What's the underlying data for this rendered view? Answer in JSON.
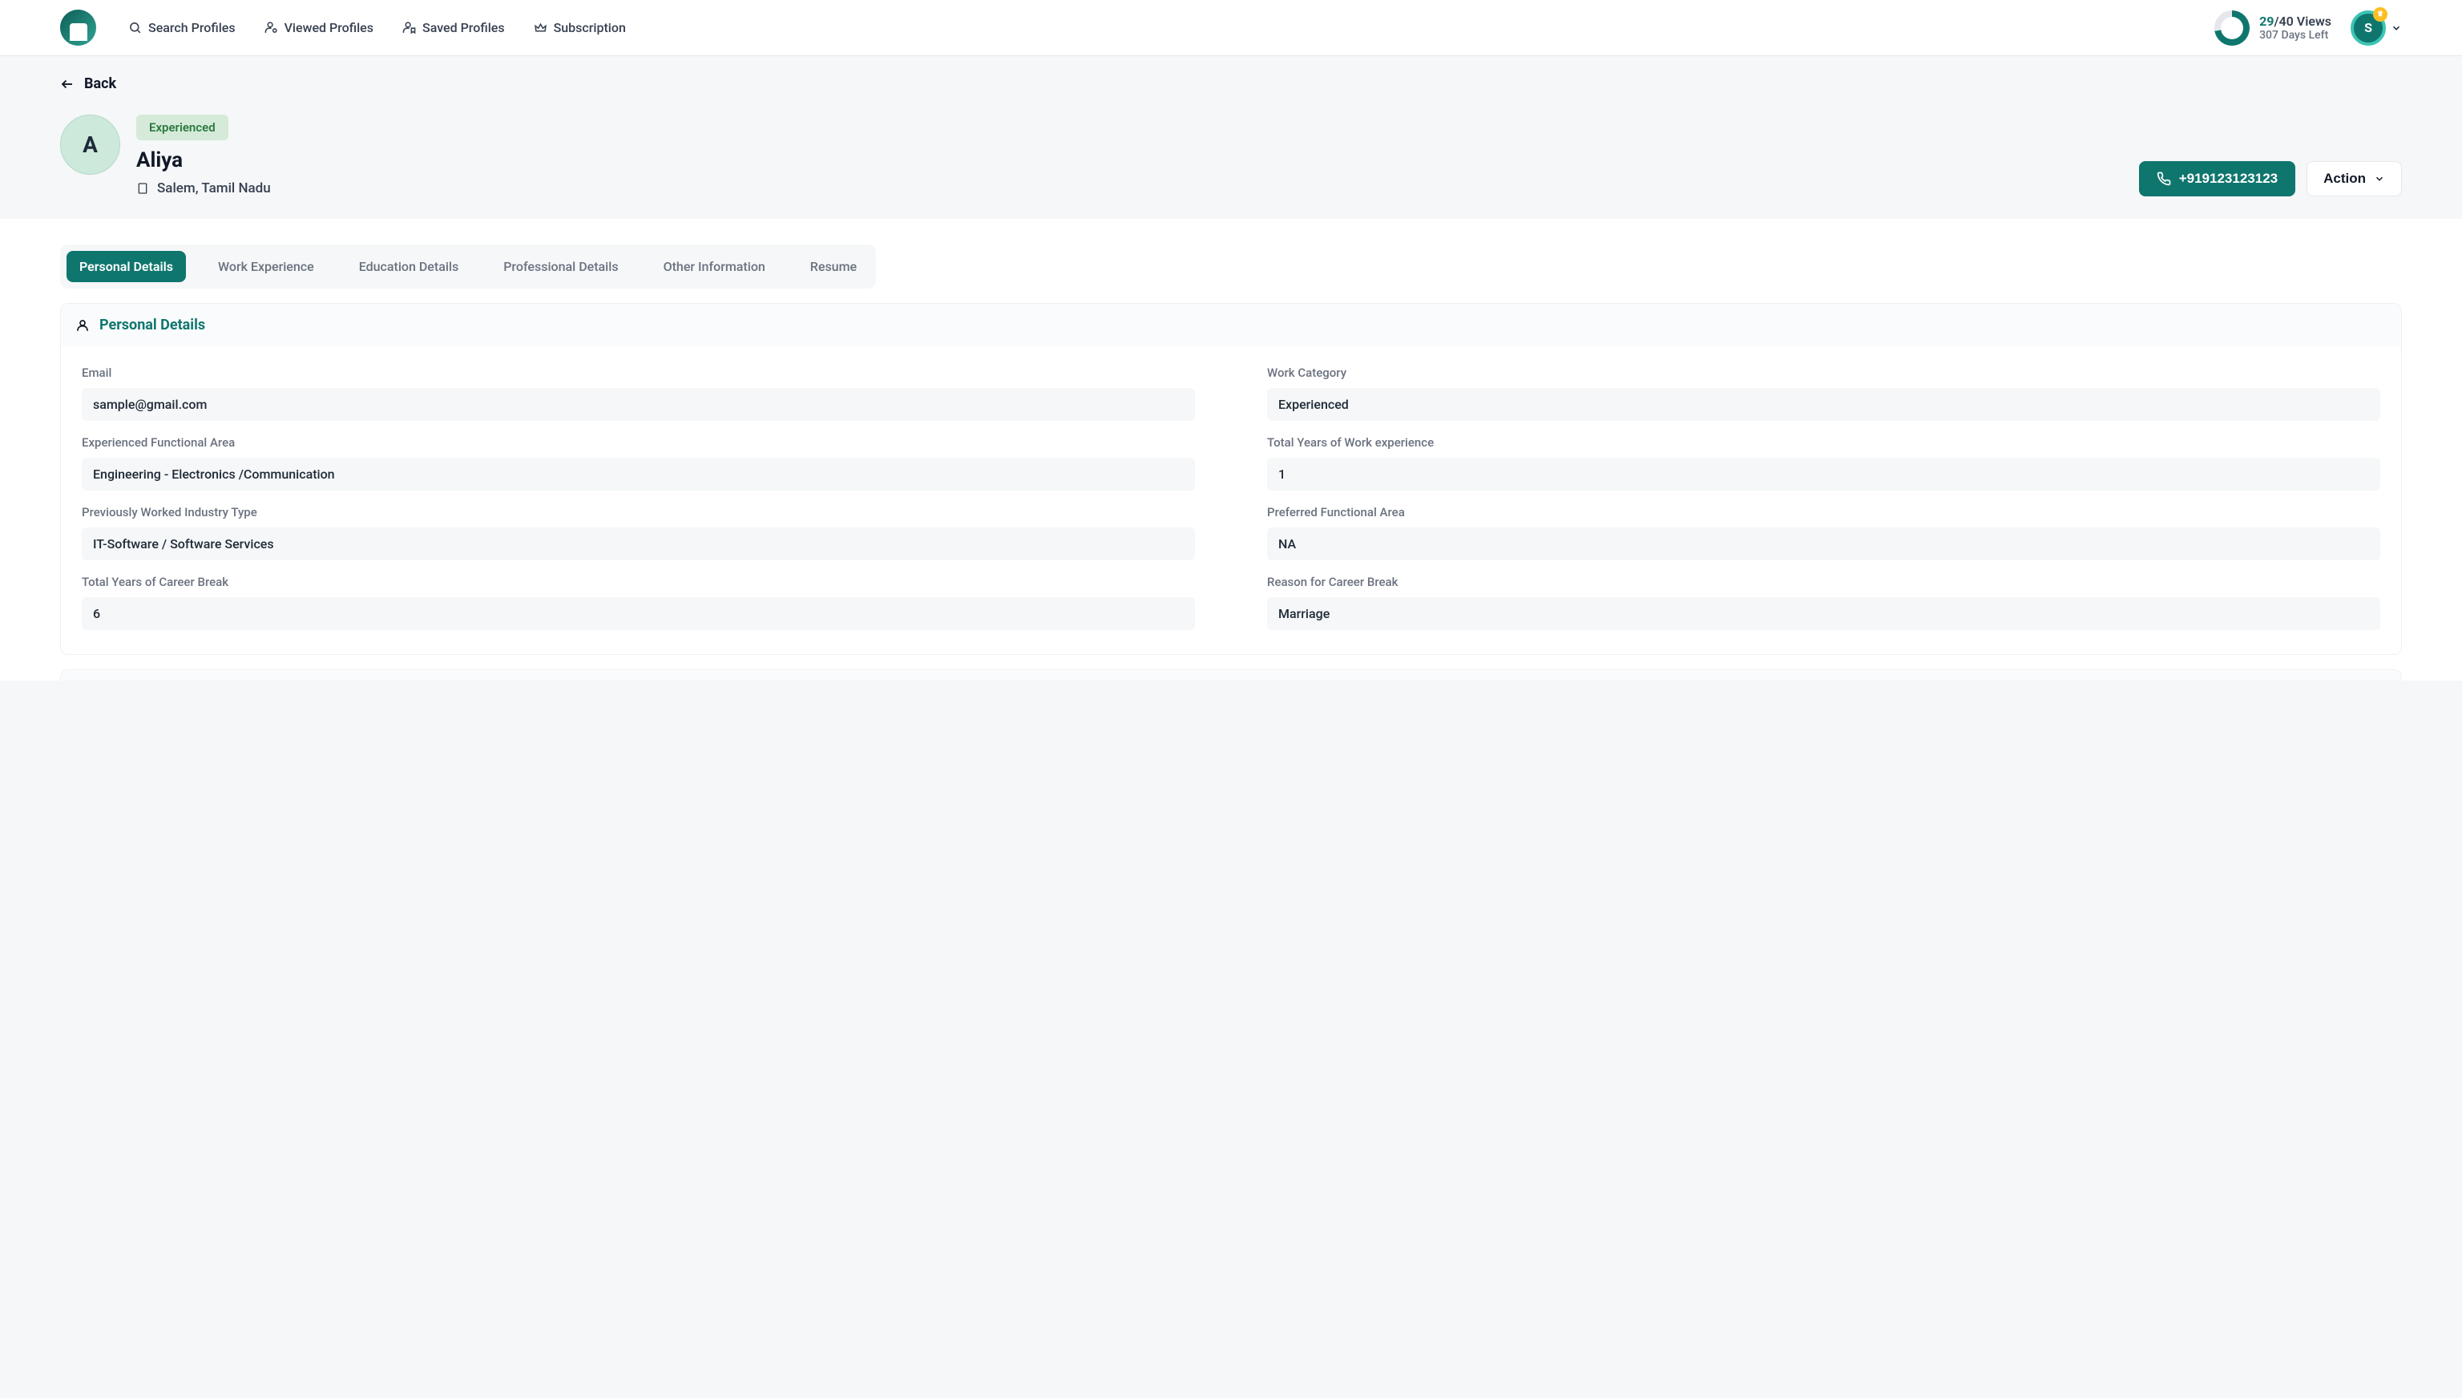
{
  "nav": {
    "search": "Search Profiles",
    "viewed": "Viewed Profiles",
    "saved": "Saved Profiles",
    "subscription": "Subscription"
  },
  "stats": {
    "views_used": "29",
    "views_total": "/40 Views",
    "days_left": "307 Days Left",
    "user_initial": "S"
  },
  "back_label": "Back",
  "profile": {
    "avatar_letter": "A",
    "badge": "Experienced",
    "name": "Aliya",
    "location": "Salem, Tamil Nadu",
    "phone": "+919123123123",
    "action_label": "Action"
  },
  "tabs": {
    "personal": "Personal Details",
    "work": "Work Experience",
    "education": "Education Details",
    "professional": "Professional Details",
    "other": "Other Information",
    "resume": "Resume"
  },
  "section_title": "Personal Details",
  "fields": {
    "email": {
      "label": "Email",
      "value": "sample@gmail.com"
    },
    "work_category": {
      "label": "Work Category",
      "value": "Experienced"
    },
    "functional_area": {
      "label": "Experienced Functional Area",
      "value": "Engineering - Electronics /Communication"
    },
    "years_experience": {
      "label": "Total Years of Work experience",
      "value": "1"
    },
    "industry_type": {
      "label": "Previously Worked Industry Type",
      "value": "IT-Software / Software Services"
    },
    "preferred_area": {
      "label": "Preferred Functional Area",
      "value": "NA"
    },
    "career_break": {
      "label": "Total Years of Career Break",
      "value": "6"
    },
    "break_reason": {
      "label": "Reason for Career Break",
      "value": "Marriage"
    }
  }
}
